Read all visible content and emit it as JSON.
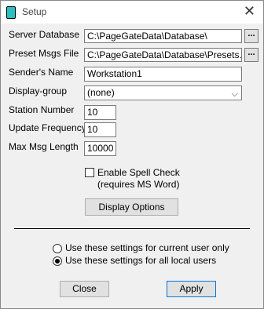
{
  "window": {
    "title": "Setup",
    "close_glyph": "✕"
  },
  "fields": {
    "server_database": {
      "label": "Server Database",
      "value": "C:\\PageGateData\\Database\\",
      "browse": "..."
    },
    "preset_msgs_file": {
      "label": "Preset Msgs File",
      "value": "C:\\PageGateData\\Database\\Presets.txt",
      "browse": "..."
    },
    "senders_name": {
      "label": "Sender's Name",
      "value": "Workstation1"
    },
    "display_group": {
      "label": "Display-group",
      "value": "(none)",
      "arrow": "⌵"
    },
    "station_number": {
      "label": "Station Number",
      "value": "10"
    },
    "update_frequency": {
      "label": "Update Frequency",
      "value": "10"
    },
    "max_msg_length": {
      "label": "Max Msg Length",
      "value": "10000"
    }
  },
  "spell_check": {
    "label": "Enable Spell Check",
    "note": "(requires MS Word)",
    "checked": false
  },
  "buttons": {
    "display_options": "Display Options",
    "close": "Close",
    "apply": "Apply"
  },
  "settings_scope": {
    "current_user": "Use these settings for current user only",
    "all_users": "Use these settings for all local users",
    "selected": "all_users"
  }
}
